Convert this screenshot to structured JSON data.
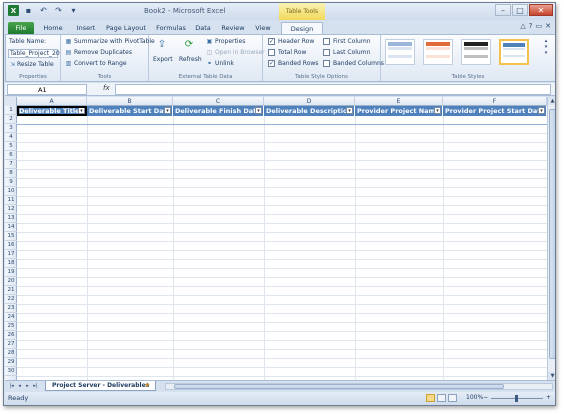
{
  "title_bar": {
    "title": "Book2 - Microsoft Excel",
    "contextual_label": "Table Tools",
    "app_icon": "X",
    "qat": {
      "undo_glyph": "↶",
      "redo_glyph": "↷",
      "save_icon": "save-icon",
      "dropdown_glyph": "▾"
    }
  },
  "window_controls": {
    "minimize": "–",
    "maximize": "□",
    "close": "✕"
  },
  "tabs": {
    "file": "File",
    "items": [
      "Home",
      "Insert",
      "Page Layout",
      "Formulas",
      "Data",
      "Review",
      "View",
      "Design"
    ],
    "active": "Design"
  },
  "help_controls": {
    "minimize_ribbon": "△",
    "help": "?",
    "restore": "▭",
    "close": "✕"
  },
  "ribbon": {
    "properties": {
      "table_name_label": "Table Name:",
      "table_name_value": "Table_Project_20",
      "resize_table": "Resize Table",
      "group_label": "Properties"
    },
    "tools": {
      "summarize": "Summarize with PivotTable",
      "remove_duplicates": "Remove Duplicates",
      "convert_to_range": "Convert to Range",
      "group_label": "Tools"
    },
    "external": {
      "export": "Export",
      "refresh": "Refresh",
      "properties": "Properties",
      "open_in_browser": "Open in Browser",
      "unlink": "Unlink",
      "group_label": "External Table Data"
    },
    "style_options": {
      "header_row": "Header Row",
      "total_row": "Total Row",
      "banded_rows": "Banded Rows",
      "first_column": "First Column",
      "last_column": "Last Column",
      "banded_columns": "Banded Columns",
      "header_row_checked": true,
      "total_row_checked": false,
      "banded_rows_checked": true,
      "first_column_checked": false,
      "last_column_checked": false,
      "banded_columns_checked": false,
      "group_label": "Table Style Options"
    },
    "styles": {
      "group_label": "Table Styles",
      "swatches": [
        {
          "head": "#9bb7d9",
          "row": "#dbe5f1"
        },
        {
          "head": "#e26b3b",
          "row": "#fbe2d5"
        },
        {
          "head": "#222222",
          "row": "#bfbfbf"
        },
        {
          "head": "#4f81bd",
          "row": "#dbe5f1"
        }
      ],
      "scroll_up": "▴",
      "scroll_down": "▾",
      "more": "▾"
    }
  },
  "formula_bar": {
    "cell_ref": "A1",
    "fx": "fx",
    "value": ""
  },
  "grid": {
    "columns": [
      "A",
      "B",
      "C",
      "D",
      "E",
      "F"
    ],
    "rows": [
      "1",
      "2",
      "3",
      "4",
      "5",
      "6",
      "7",
      "8",
      "9",
      "10",
      "11",
      "12",
      "13",
      "14",
      "15",
      "16",
      "17",
      "18",
      "19",
      "20",
      "21",
      "22",
      "23",
      "24",
      "25",
      "26",
      "27",
      "28",
      "29",
      "30"
    ],
    "table_headers": [
      "Deliverable Title",
      "Deliverable Start Date",
      "Deliverable Finish Date",
      "Deliverable Description",
      "Provider Project Name",
      "Provider Project Start Date"
    ],
    "header_color": "#4f81bd",
    "dropdown_glyph": "▾"
  },
  "sheet_tabs": {
    "nav": [
      "|◂",
      "◂",
      "▸",
      "▸|"
    ],
    "active": "Project Server - Deliverables",
    "new_sheet": "✚"
  },
  "status_bar": {
    "ready": "Ready",
    "zoom": "100%",
    "zoom_minus": "−",
    "zoom_plus": "+"
  },
  "scroll": {
    "up": "▲",
    "down": "▼"
  }
}
